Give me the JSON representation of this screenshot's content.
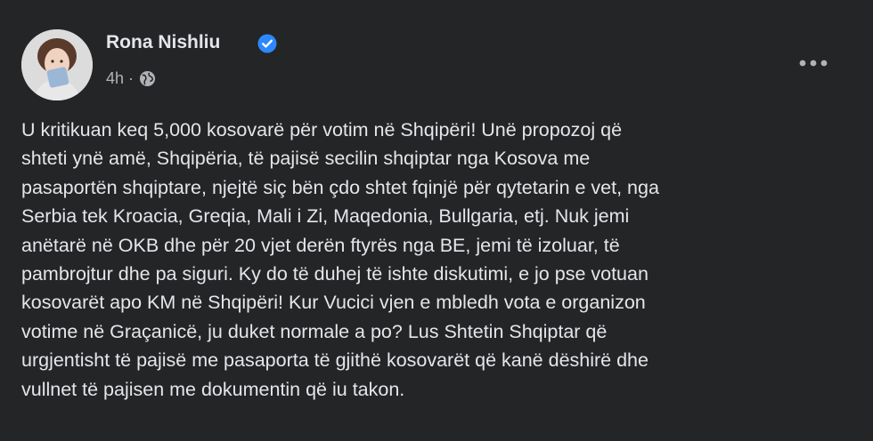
{
  "author": {
    "name": "Rona Nishliu",
    "verified_icon": "verified-badge-icon",
    "avatar_icon": "profile-photo"
  },
  "meta": {
    "time": "4h",
    "separator": "·",
    "audience_icon": "globe-icon"
  },
  "menu": {
    "more_icon": "more-options-icon"
  },
  "post": {
    "lines": [
      "U kritikuan keq 5,000 kosovarë për votim në Shqipëri! Unë propozoj që",
      "shteti ynë amë, Shqipëria, të pajisë secilin shqiptar nga Kosova me",
      "pasaportën shqiptare, njejtë siç bën çdo shtet fqinjë për qytetarin e vet, nga",
      "Serbia tek Kroacia, Greqia, Mali i Zi, Maqedonia, Bullgaria, etj. Nuk jemi",
      "anëtarë në OKB dhe për 20 vjet derën ftyrës nga BE, jemi të izoluar, të",
      "pambrojtur dhe pa siguri. Ky do të duhej të ishte diskutimi, e jo pse votuan",
      "kosovarët apo KM në Shqipëri! Kur Vucici vjen e mbledh vota e organizon",
      "votime në Graçanicë, ju duket normale a po? Lus Shtetin Shqiptar që",
      "urgjentisht të pajisë me pasaporta të gjithë kosovarët që kanë dëshirë dhe",
      "vullnet të pajisen me dokumentin që iu takon."
    ]
  },
  "colors": {
    "background": "#242526",
    "primary_text": "#e4e6eb",
    "secondary_text": "#b0b3b8",
    "verified": "#2d88ff"
  }
}
